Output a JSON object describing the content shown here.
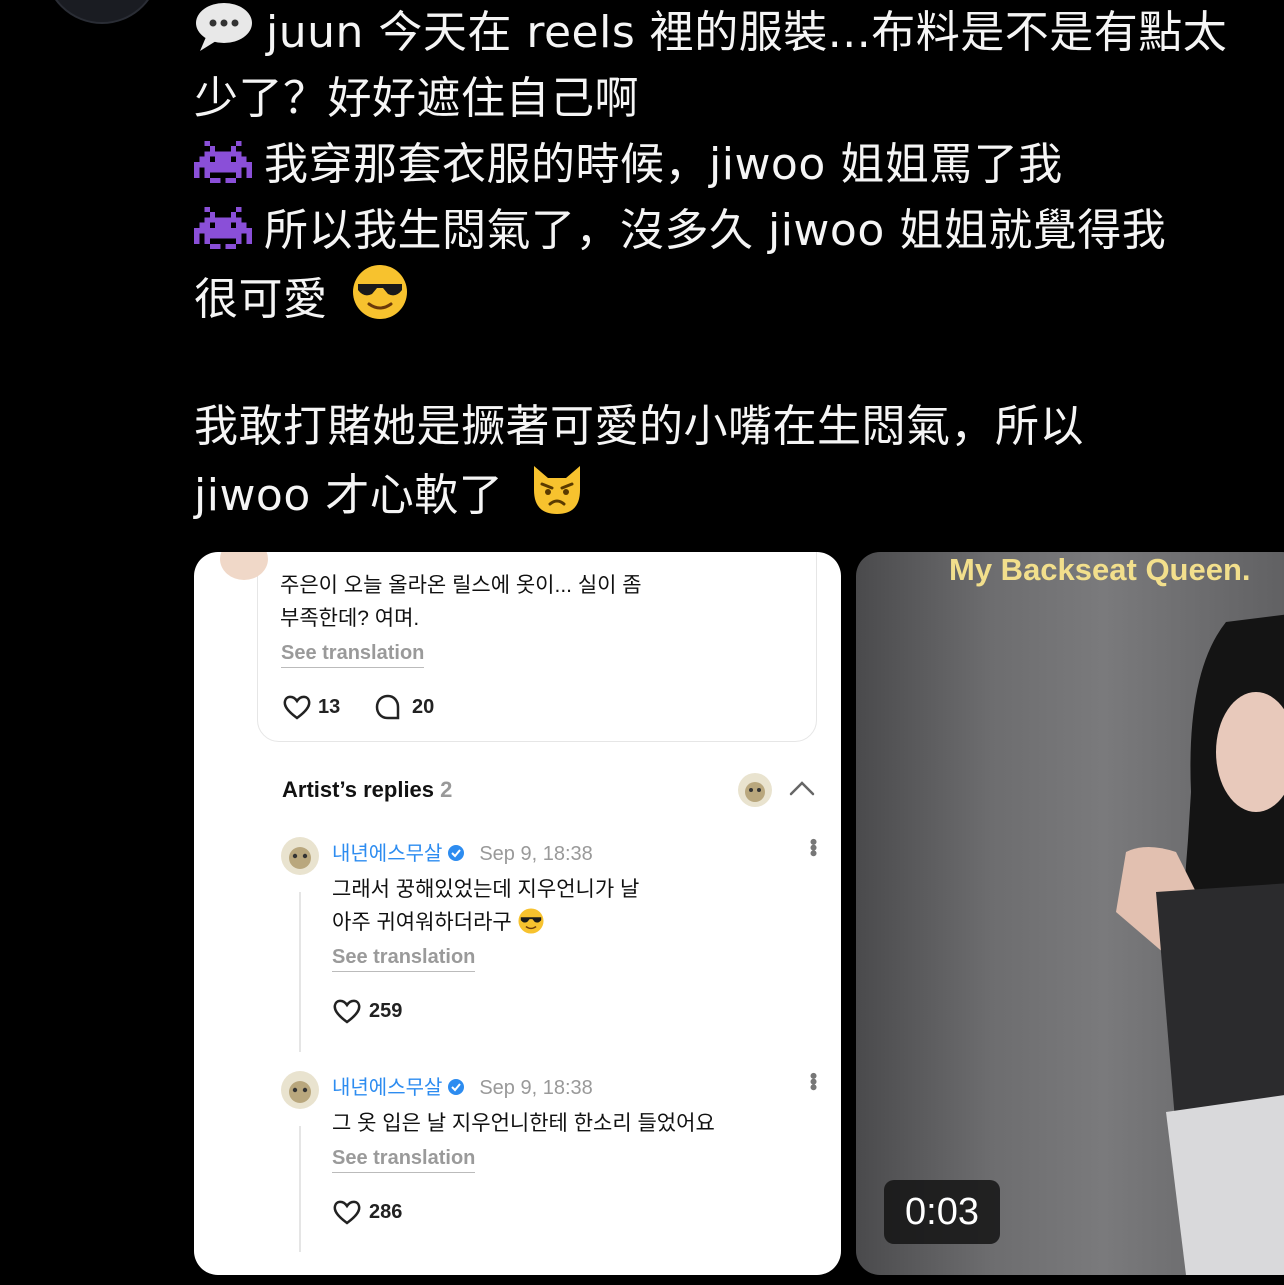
{
  "post": {
    "line1": "juun 今天在 reels 裡的服裝...布料是不是有點太",
    "line2": "少了？好好遮住自己啊",
    "line3": "我穿那套衣服的時候，jiwoo 姐姐罵了我",
    "line4": "所以我生悶氣了，沒多久 jiwoo 姐姐就覺得我",
    "line5": "很可愛",
    "line6": "我敢打賭她是撅著可愛的小嘴在生悶氣，所以",
    "line7": "jiwoo 才心軟了",
    "icons": [
      "speech-bubble-icon",
      "alien-monster-icon",
      "sunglasses-face-icon",
      "pouting-cat-icon"
    ]
  },
  "screenshot_card": {
    "original_comment": {
      "text_line1": "주은이 오늘 올라온 릴스에 옷이... 실이 좀",
      "text_line2": "부족한데? 여며.",
      "see_translation": "See translation",
      "likes": "13",
      "replies": "20"
    },
    "artist_replies": {
      "title": "Artist’s replies",
      "count": "2"
    },
    "replies": [
      {
        "name": "내년에스무살",
        "time": "Sep 9, 18:38",
        "text_line1": "그래서 꿍해있었는데 지우언니가 날",
        "text_line2": "아주 귀여워하더라구",
        "see_translation": "See translation",
        "likes": "259"
      },
      {
        "name": "내년에스무살",
        "time": "Sep 9, 18:38",
        "text_line1": "그 옷 입은 날 지우언니한테 한소리 들었어요",
        "see_translation": "See translation",
        "likes": "286"
      }
    ]
  },
  "video": {
    "caption": "My Backseat Queen.",
    "timer": "0:03"
  },
  "colors": {
    "verified": "#2d8cf0",
    "caption": "#f2df8c",
    "background": "#000000"
  }
}
